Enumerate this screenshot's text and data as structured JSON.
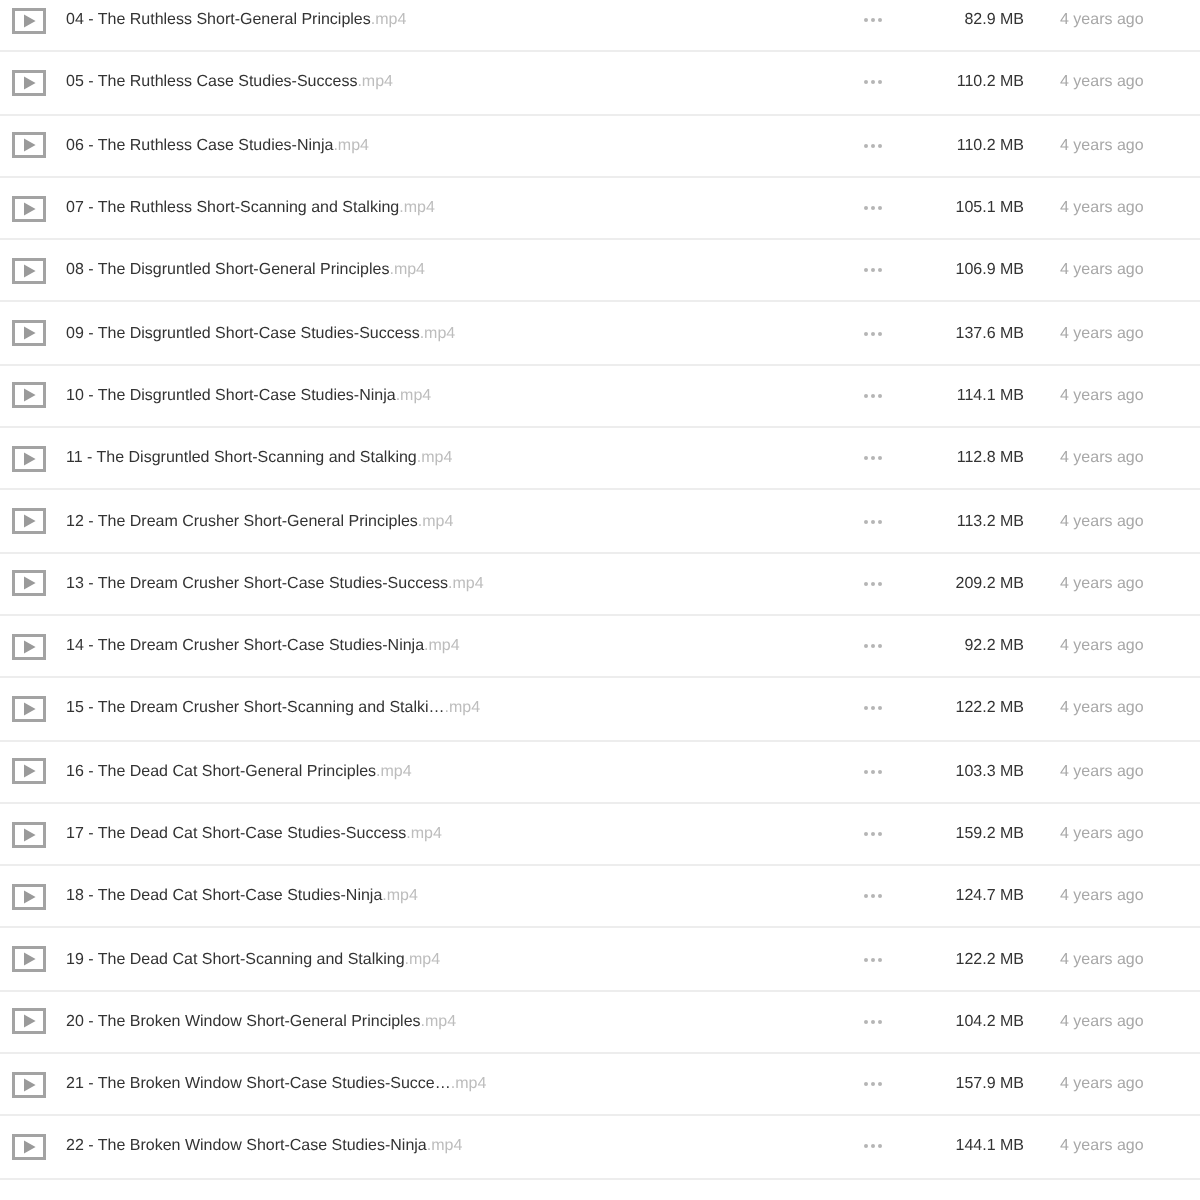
{
  "files": [
    {
      "name": "04 - The Ruthless Short-General Principles",
      "extension": ".mp4",
      "size": "82.9 MB",
      "modified": "4 years ago"
    },
    {
      "name": "05 - The Ruthless Case Studies-Success",
      "extension": ".mp4",
      "size": "110.2 MB",
      "modified": "4 years ago"
    },
    {
      "name": "06 - The Ruthless Case Studies-Ninja",
      "extension": ".mp4",
      "size": "110.2 MB",
      "modified": "4 years ago"
    },
    {
      "name": "07 - The Ruthless Short-Scanning and Stalking",
      "extension": ".mp4",
      "size": "105.1 MB",
      "modified": "4 years ago"
    },
    {
      "name": "08 - The Disgruntled Short-General Principles",
      "extension": ".mp4",
      "size": "106.9 MB",
      "modified": "4 years ago"
    },
    {
      "name": "09 - The Disgruntled Short-Case Studies-Success",
      "extension": ".mp4",
      "size": "137.6 MB",
      "modified": "4 years ago"
    },
    {
      "name": "10 - The Disgruntled Short-Case Studies-Ninja",
      "extension": ".mp4",
      "size": "114.1 MB",
      "modified": "4 years ago"
    },
    {
      "name": "11 - The Disgruntled Short-Scanning and Stalking",
      "extension": ".mp4",
      "size": "112.8 MB",
      "modified": "4 years ago"
    },
    {
      "name": "12 - The Dream Crusher Short-General Principles",
      "extension": ".mp4",
      "size": "113.2 MB",
      "modified": "4 years ago"
    },
    {
      "name": "13 - The Dream Crusher Short-Case Studies-Success",
      "extension": ".mp4",
      "size": "209.2 MB",
      "modified": "4 years ago"
    },
    {
      "name": "14 - The Dream Crusher Short-Case Studies-Ninja",
      "extension": ".mp4",
      "size": "92.2 MB",
      "modified": "4 years ago"
    },
    {
      "name": "15 - The Dream Crusher Short-Scanning and Stalki…",
      "extension": ".mp4",
      "size": "122.2 MB",
      "modified": "4 years ago"
    },
    {
      "name": "16 - The Dead Cat Short-General Principles",
      "extension": ".mp4",
      "size": "103.3 MB",
      "modified": "4 years ago"
    },
    {
      "name": "17 - The Dead Cat Short-Case Studies-Success",
      "extension": ".mp4",
      "size": "159.2 MB",
      "modified": "4 years ago"
    },
    {
      "name": "18 - The Dead Cat Short-Case Studies-Ninja",
      "extension": ".mp4",
      "size": "124.7 MB",
      "modified": "4 years ago"
    },
    {
      "name": "19 - The Dead Cat Short-Scanning and Stalking",
      "extension": ".mp4",
      "size": "122.2 MB",
      "modified": "4 years ago"
    },
    {
      "name": "20 - The Broken Window Short-General Principles",
      "extension": ".mp4",
      "size": "104.2 MB",
      "modified": "4 years ago"
    },
    {
      "name": "21 - The Broken Window Short-Case Studies-Succe…",
      "extension": ".mp4",
      "size": "157.9 MB",
      "modified": "4 years ago"
    },
    {
      "name": "22 - The Broken Window Short-Case Studies-Ninja",
      "extension": ".mp4",
      "size": "144.1 MB",
      "modified": "4 years ago"
    }
  ]
}
